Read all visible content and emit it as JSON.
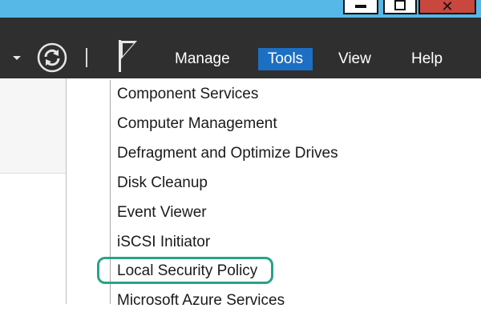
{
  "window": {
    "minimize_icon": "minimize-icon",
    "maximize_icon": "restore-icon",
    "close_icon": "close-icon",
    "close_glyph": "✕"
  },
  "menubar": {
    "items": [
      {
        "label": "Manage"
      },
      {
        "label": "Tools",
        "active": true
      },
      {
        "label": "View"
      },
      {
        "label": "Help"
      }
    ],
    "icons": [
      "chevron-down-icon",
      "refresh-icon",
      "flag-icon"
    ]
  },
  "tools_menu": {
    "items": [
      {
        "label": "Component Services"
      },
      {
        "label": "Computer Management"
      },
      {
        "label": "Defragment and Optimize Drives"
      },
      {
        "label": "Disk Cleanup"
      },
      {
        "label": "Event Viewer"
      },
      {
        "label": "iSCSI Initiator"
      },
      {
        "label": "Local Security Policy",
        "highlighted": true
      },
      {
        "label": "Microsoft Azure Services"
      }
    ]
  },
  "colors": {
    "titlebar": "#55b8e6",
    "menubar": "#2f2f2f",
    "active_menu": "#1c6fc2",
    "highlight_outline": "#27a387",
    "close_button": "#c8473e"
  }
}
